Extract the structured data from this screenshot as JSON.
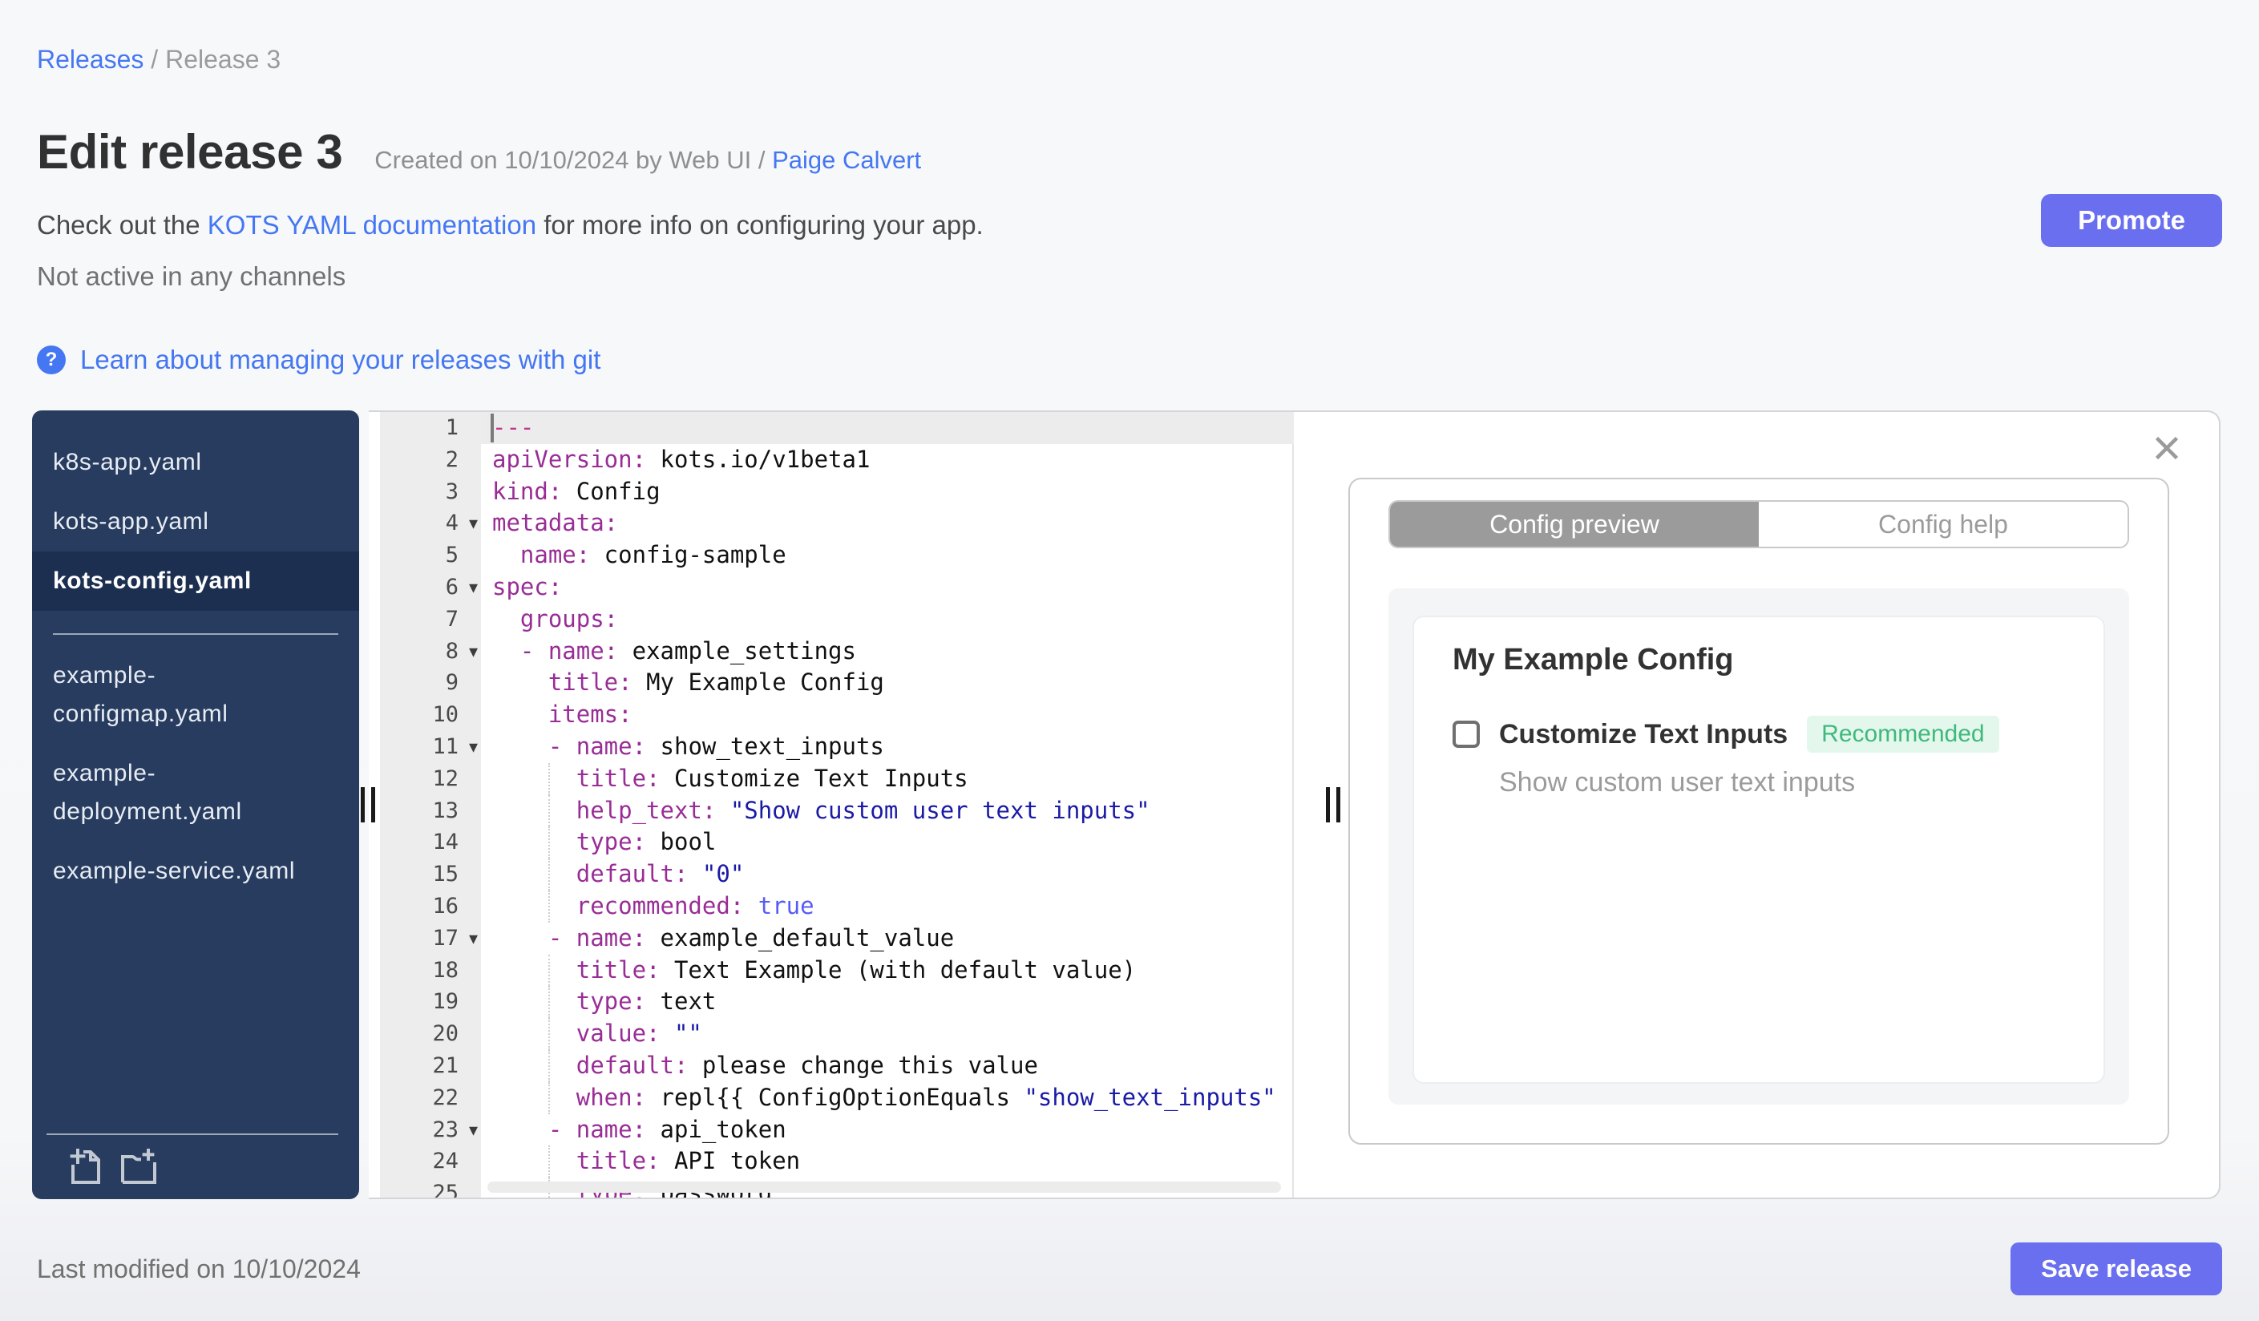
{
  "breadcrumb": {
    "link": "Releases",
    "separator": " / ",
    "current": "Release 3"
  },
  "header": {
    "title": "Edit release 3",
    "created_prefix": "Created on 10/10/2024 by Web UI /",
    "created_link": "Paige Calvert"
  },
  "doc_line": {
    "pre": "Check out the ",
    "link": "KOTS YAML documentation",
    "post": " for more info on configuring your app."
  },
  "status_line": "Not active in any channels",
  "learn": {
    "icon": "?",
    "label": "Learn about managing your releases with git"
  },
  "promote_label": "Promote",
  "sidebar": {
    "divider_after": 2,
    "files": [
      {
        "label": "k8s-app.yaml",
        "selected": false
      },
      {
        "label": "kots-app.yaml",
        "selected": false
      },
      {
        "label": "kots-config.yaml",
        "selected": true
      },
      {
        "label": "example-configmap.yaml",
        "selected": false
      },
      {
        "label": "example-deployment.yaml",
        "selected": false
      },
      {
        "label": "example-service.yaml",
        "selected": false
      }
    ],
    "actions": [
      "add-file",
      "add-folder"
    ]
  },
  "editor": {
    "lines": [
      {
        "n": 1,
        "active": true,
        "tokens": [
          [
            "sep",
            "---"
          ]
        ]
      },
      {
        "n": 2,
        "tokens": [
          [
            "key",
            "apiVersion:"
          ],
          [
            "plain",
            " kots.io/v1beta1"
          ]
        ]
      },
      {
        "n": 3,
        "tokens": [
          [
            "key",
            "kind:"
          ],
          [
            "plain",
            " Config"
          ]
        ]
      },
      {
        "n": 4,
        "fold": true,
        "tokens": [
          [
            "key",
            "metadata:"
          ]
        ]
      },
      {
        "n": 5,
        "tokens": [
          [
            "key",
            "  name:"
          ],
          [
            "plain",
            " config-sample"
          ]
        ]
      },
      {
        "n": 6,
        "fold": true,
        "tokens": [
          [
            "key",
            "spec:"
          ]
        ]
      },
      {
        "n": 7,
        "tokens": [
          [
            "key",
            "  groups:"
          ]
        ]
      },
      {
        "n": 8,
        "fold": true,
        "tokens": [
          [
            "key",
            "  - name:"
          ],
          [
            "plain",
            " example_settings"
          ]
        ]
      },
      {
        "n": 9,
        "tokens": [
          [
            "key",
            "    title:"
          ],
          [
            "plain",
            " My Example Config"
          ]
        ]
      },
      {
        "n": 10,
        "tokens": [
          [
            "key",
            "    items:"
          ]
        ]
      },
      {
        "n": 11,
        "fold": true,
        "tokens": [
          [
            "key",
            "    - name:"
          ],
          [
            "plain",
            " show_text_inputs"
          ]
        ]
      },
      {
        "n": 12,
        "guide": true,
        "tokens": [
          [
            "key",
            "      title:"
          ],
          [
            "plain",
            " Customize Text Inputs"
          ]
        ]
      },
      {
        "n": 13,
        "guide": true,
        "tokens": [
          [
            "key",
            "      help_text:"
          ],
          [
            "str",
            " \"Show custom user text inputs\""
          ]
        ]
      },
      {
        "n": 14,
        "guide": true,
        "tokens": [
          [
            "key",
            "      type:"
          ],
          [
            "plain",
            " bool"
          ]
        ]
      },
      {
        "n": 15,
        "guide": true,
        "tokens": [
          [
            "key",
            "      default:"
          ],
          [
            "str",
            " \"0\""
          ]
        ]
      },
      {
        "n": 16,
        "guide": true,
        "tokens": [
          [
            "key",
            "      recommended:"
          ],
          [
            "bool",
            " true"
          ]
        ]
      },
      {
        "n": 17,
        "fold": true,
        "tokens": [
          [
            "key",
            "    - name:"
          ],
          [
            "plain",
            " example_default_value"
          ]
        ]
      },
      {
        "n": 18,
        "guide": true,
        "tokens": [
          [
            "key",
            "      title:"
          ],
          [
            "plain",
            " Text Example (with default value)"
          ]
        ]
      },
      {
        "n": 19,
        "guide": true,
        "tokens": [
          [
            "key",
            "      type:"
          ],
          [
            "plain",
            " text"
          ]
        ]
      },
      {
        "n": 20,
        "guide": true,
        "tokens": [
          [
            "key",
            "      value:"
          ],
          [
            "str",
            " \"\""
          ]
        ]
      },
      {
        "n": 21,
        "guide": true,
        "tokens": [
          [
            "key",
            "      default:"
          ],
          [
            "plain",
            " please change this value"
          ]
        ]
      },
      {
        "n": 22,
        "guide": true,
        "tokens": [
          [
            "key",
            "      when:"
          ],
          [
            "plain",
            " repl{{ ConfigOptionEquals "
          ],
          [
            "str",
            "\"show_text_inputs\""
          ]
        ]
      },
      {
        "n": 23,
        "fold": true,
        "tokens": [
          [
            "key",
            "    - name:"
          ],
          [
            "plain",
            " api_token"
          ]
        ]
      },
      {
        "n": 24,
        "guide": true,
        "tokens": [
          [
            "key",
            "      title:"
          ],
          [
            "plain",
            " API token"
          ]
        ]
      },
      {
        "n": 25,
        "guide": true,
        "tokens": [
          [
            "key",
            "      type:"
          ],
          [
            "plain",
            " password"
          ]
        ]
      }
    ]
  },
  "preview": {
    "tabs": [
      {
        "label": "Config preview",
        "active": true
      },
      {
        "label": "Config help",
        "active": false
      }
    ],
    "close_icon": "close",
    "group_title": "My Example Config",
    "item": {
      "label": "Customize Text Inputs",
      "badge": "Recommended",
      "help": "Show custom user text inputs",
      "checked": false
    }
  },
  "footer": {
    "last_modified": "Last modified on 10/10/2024",
    "save_label": "Save release"
  }
}
